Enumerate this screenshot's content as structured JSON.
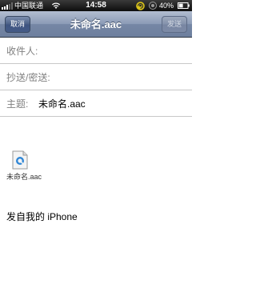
{
  "status_bar": {
    "carrier": "中国联通",
    "time": "14:58",
    "battery": "40%"
  },
  "nav": {
    "cancel_label": "取消",
    "title": "未命名.aac",
    "send_label": "发送"
  },
  "compose": {
    "to_label": "收件人:",
    "cc_bcc_label": "抄送/密送:",
    "subject_label": "主题:",
    "subject_value": "未命名.aac"
  },
  "attachment": {
    "name": "未命名.aac",
    "icon": "quicktime-file-icon"
  },
  "body": {
    "signature": "发自我的 iPhone"
  },
  "colors": {
    "nav_bar": "#8b9bb6",
    "label_gray": "#808080",
    "divider": "#c8c8c8"
  }
}
